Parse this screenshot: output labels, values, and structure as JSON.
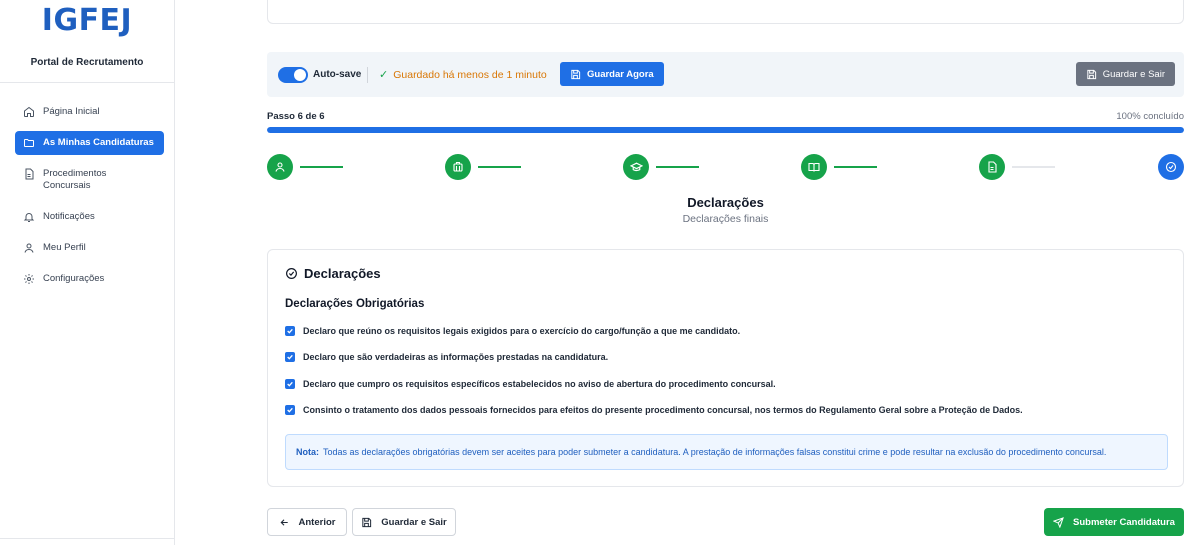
{
  "sidebar": {
    "logo": "IGFEJ",
    "portal": "Portal de Recrutamento",
    "items": [
      {
        "label": "Página Inicial",
        "icon": "home-icon"
      },
      {
        "label": "As Minhas Candidaturas",
        "icon": "folder-icon",
        "active": true
      },
      {
        "label": "Procedimentos\nConcursais",
        "icon": "document-icon"
      },
      {
        "label": "Notificações",
        "icon": "bell-icon"
      },
      {
        "label": "Meu Perfil",
        "icon": "user-icon"
      },
      {
        "label": "Configurações",
        "icon": "gear-icon"
      }
    ]
  },
  "savebar": {
    "autosave_label": "Auto-save",
    "autosave_on": true,
    "status": "Guardado há menos de 1 minuto",
    "save_now": "Guardar Agora",
    "save_exit": "Guardar e Sair"
  },
  "progress": {
    "step_label": "Passo 6 de 6",
    "percent_label": "100% concluído",
    "percent": 100
  },
  "stepper": {
    "steps": [
      {
        "icon": "user-icon",
        "state": "done"
      },
      {
        "icon": "building-icon",
        "state": "done"
      },
      {
        "icon": "graduation-cap-icon",
        "state": "done"
      },
      {
        "icon": "book-icon",
        "state": "done"
      },
      {
        "icon": "file-text-icon",
        "state": "done"
      },
      {
        "icon": "check-circle-icon",
        "state": "current"
      }
    ],
    "colors": {
      "done": "#16a34a",
      "current": "#1f6fe5",
      "pending_line": "#e5e7eb"
    }
  },
  "section": {
    "title": "Declarações",
    "subtitle": "Declarações finais"
  },
  "declarations": {
    "heading": "Declarações",
    "subheading": "Declarações Obrigatórias",
    "items": [
      {
        "text": "Declaro que reúno os requisitos legais exigidos para o exercício do cargo/função a que me candidato.",
        "checked": true
      },
      {
        "text": "Declaro que são verdadeiras as informações prestadas na candidatura.",
        "checked": true
      },
      {
        "text": "Declaro que cumpro os requisitos específicos estabelecidos no aviso de abertura do procedimento concursal.",
        "checked": true
      },
      {
        "text": "Consinto o tratamento dos dados pessoais fornecidos para efeitos do presente procedimento concursal, nos termos do Regulamento Geral sobre a Proteção de Dados.",
        "checked": true
      }
    ],
    "note_label": "Nota:",
    "note_text": "Todas as declarações obrigatórias devem ser aceites para poder submeter a candidatura. A prestação de informações falsas constitui crime e pode resultar na exclusão do procedimento concursal."
  },
  "footer": {
    "prev": "Anterior",
    "save_exit": "Guardar e Sair",
    "submit": "Submeter Candidatura"
  }
}
